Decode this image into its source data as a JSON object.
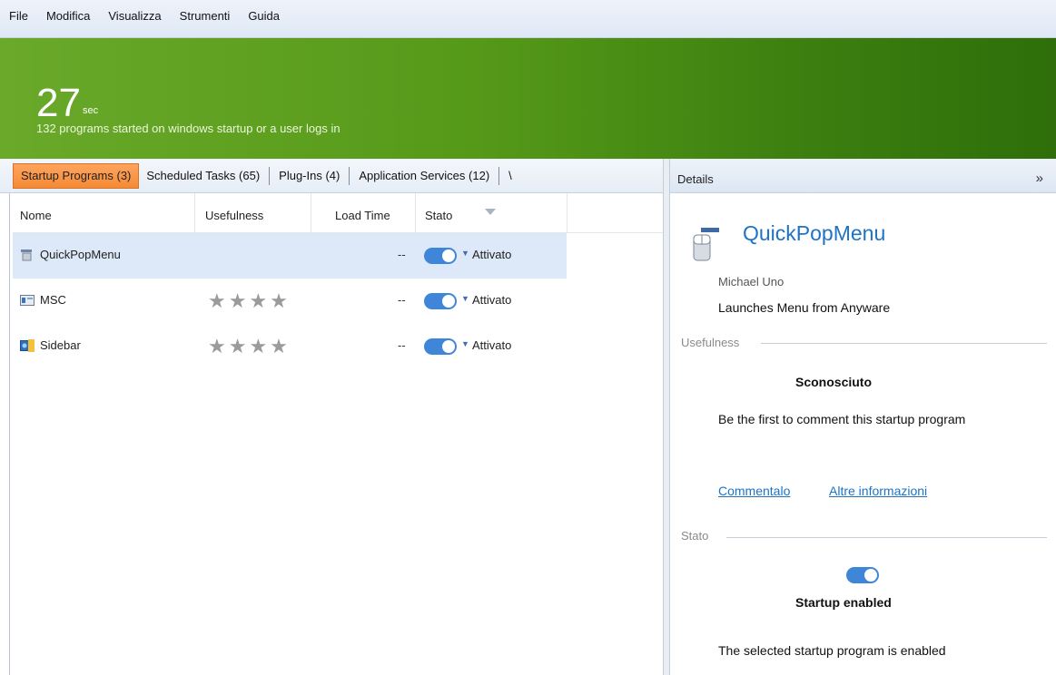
{
  "menu": [
    "File",
    "Modifica",
    "Visualizza",
    "Strumenti",
    "Guida"
  ],
  "banner": {
    "value": "27",
    "unit": "sec",
    "subtitle": "132 programs started on windows startup or a user logs in"
  },
  "tabs": [
    {
      "label": "Startup Programs (3)",
      "active": true
    },
    {
      "label": "Scheduled Tasks (65)",
      "active": false
    },
    {
      "label": "Plug-Ins (4)",
      "active": false
    },
    {
      "label": "Application Services (12)",
      "active": false
    },
    {
      "label": "\\",
      "active": false
    }
  ],
  "columns": {
    "name": "Nome",
    "usefulness": "Usefulness",
    "load_time": "Load Time",
    "state": "Stato"
  },
  "rows": [
    {
      "name": "QuickPopMenu",
      "icon": "app-icon",
      "stars": "",
      "load_time": "--",
      "state": "Attivato",
      "enabled": true,
      "selected": true
    },
    {
      "name": "MSC",
      "icon": "window-icon",
      "stars": "★★★★",
      "load_time": "--",
      "state": "Attivato",
      "enabled": true,
      "selected": false
    },
    {
      "name": "Sidebar",
      "icon": "sidebar-icon",
      "stars": "★★★★",
      "load_time": "--",
      "state": "Attivato",
      "enabled": true,
      "selected": false
    }
  ],
  "details": {
    "header": "Details",
    "collapse_icon": "»",
    "title": "QuickPopMenu",
    "author": "Michael Uno",
    "description": "Launches Menu from Anyware",
    "usefulness_label": "Usefulness",
    "rating": "Sconosciuto",
    "comment_prompt": "Be the first to comment this startup program",
    "link_comment": "Commentalo",
    "link_more": "Altre informazioni",
    "state_label": "Stato",
    "enabled_title": "Startup enabled",
    "enabled_desc": "The selected startup program is enabled"
  }
}
